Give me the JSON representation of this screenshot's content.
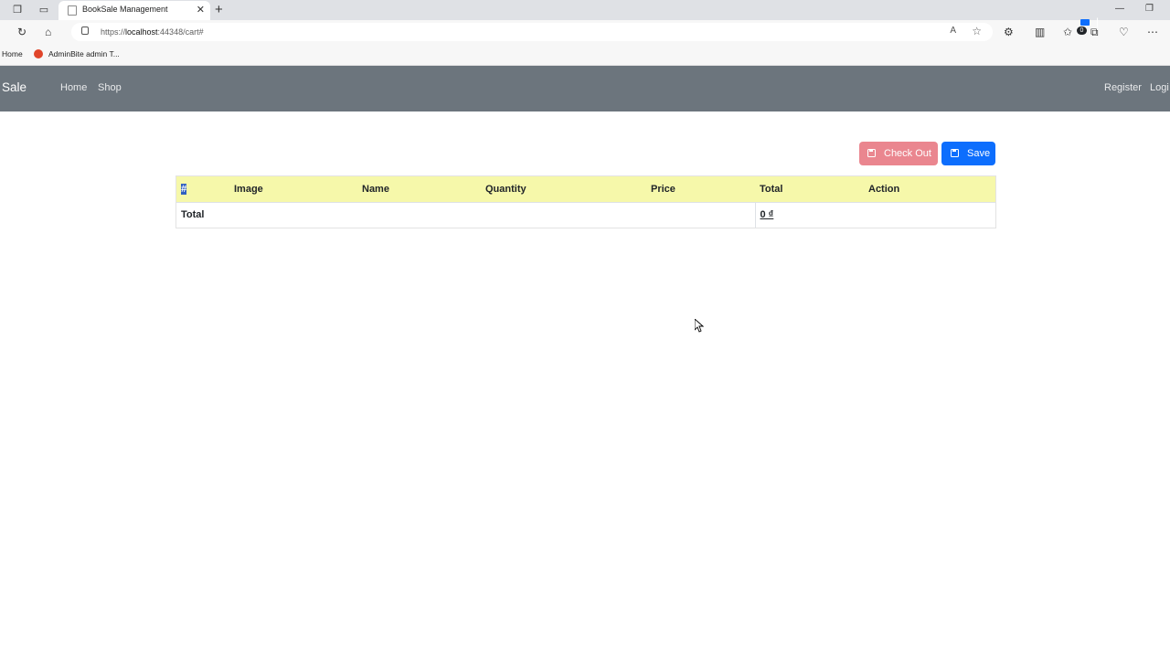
{
  "browser": {
    "tab_title": "BookSale Management",
    "url_prefix": "https://",
    "url_host": "localhost",
    "url_rest": ":44348/cart#",
    "bookmarks": [
      "Home",
      "AdminBite admin T..."
    ],
    "read_aloud_label": "A"
  },
  "navbar": {
    "brand": "ok Sale",
    "links": [
      "Home",
      "Shop"
    ],
    "cart_count": "0",
    "separator": "|",
    "register": "Register",
    "login": "Logi"
  },
  "actions": {
    "checkout_label": "Check Out",
    "save_label": "Save"
  },
  "table": {
    "columns": [
      "#",
      "Image",
      "Name",
      "Quantity",
      "Price",
      "Total",
      "Action"
    ],
    "rows": [],
    "footer": {
      "label": "Total",
      "value": "0 ₫"
    }
  },
  "colors": {
    "navbar_bg": "#6c757d",
    "header_bg": "#f6f8aa",
    "checkout_bg": "#ea868f",
    "save_bg": "#0d6efd"
  }
}
